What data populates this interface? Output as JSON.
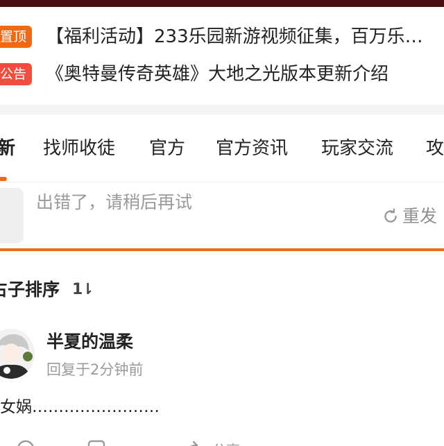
{
  "notices": [
    {
      "tag": "置顶",
      "text": "【福利活动】233乐园新游视频征集，百万乐…"
    },
    {
      "tag": "公告",
      "text": "《奥特曼传奇英雄》大地之光版本更新介绍"
    }
  ],
  "tabs": [
    {
      "label": "新",
      "active": true
    },
    {
      "label": "找师收徒",
      "active": false
    },
    {
      "label": "官方",
      "active": false
    },
    {
      "label": "官方资讯",
      "active": false
    },
    {
      "label": "玩家交流",
      "active": false
    },
    {
      "label": "攻",
      "active": false
    }
  ],
  "error": {
    "message": "出错了，请稍后再试",
    "retry_label": "重发"
  },
  "sort": {
    "label": "占子排序",
    "icon_text": "1⇂"
  },
  "post": {
    "username": "半夏的温柔",
    "reply_time": "回复于2分钟前",
    "body": "女娲……………………",
    "actions": [
      {
        "icon": "comment-icon"
      },
      {
        "icon": "like-icon"
      },
      {
        "icon": "share-icon"
      }
    ],
    "share_label": "分享"
  },
  "colors": {
    "accent": "#f06a16",
    "announce": "#f04f3f",
    "top_strip": "#4a0f12"
  }
}
